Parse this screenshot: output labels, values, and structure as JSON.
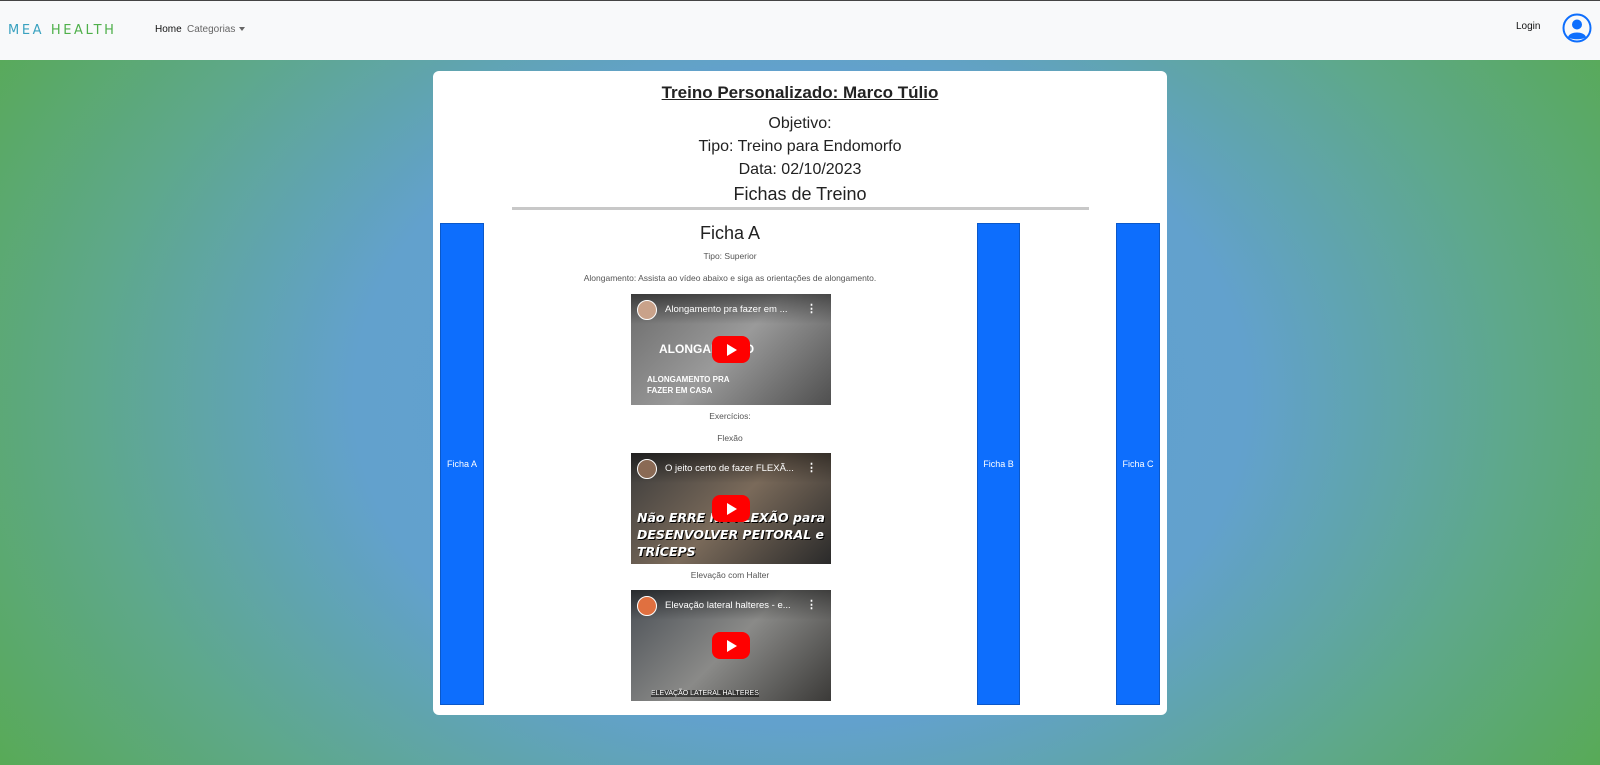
{
  "nav": {
    "brand_part1": "MEA",
    "brand_part2": "HEALTH",
    "home": "Home",
    "categorias": "Categorias",
    "login": "Login"
  },
  "header": {
    "title": "Treino Personalizado: Marco Túlio",
    "objetivo": "Objetivo:",
    "tipo": "Tipo: Treino para Endomorfo",
    "data": "Data: 02/10/2023",
    "section_title": "Fichas de Treino"
  },
  "tabs": [
    {
      "label": "Ficha A"
    },
    {
      "label": "Ficha B"
    },
    {
      "label": "Ficha C"
    }
  ],
  "ficha": {
    "title": "Ficha A",
    "tipo": "Tipo: Superior",
    "alongamento": "Alongamento: Assista ao vídeo abaixo e siga as orientações de alongamento.",
    "exercicios_label": "Exercícios:",
    "videos": [
      {
        "title": "Alongamento pra fazer em ...",
        "overlay_big": "ALONGAMENTO",
        "overlay_small": "ALONGAMENTO PRA FAZER EM CASA"
      },
      {
        "title": "O jeito certo de fazer FLEXÃ...",
        "overlay_big": "Não ERRE NA FLEXÃO para DESENVOLVER PEITORAL e TRÍCEPS"
      },
      {
        "title": "Elevação lateral halteres - e...",
        "overlay_small": "ELEVAÇÃO LATERAL HALTERES"
      }
    ],
    "exercises": [
      "Flexão",
      "Elevação com Halter"
    ]
  },
  "colors": {
    "accent": "#0d6efd",
    "youtube_red": "#ff0000"
  }
}
